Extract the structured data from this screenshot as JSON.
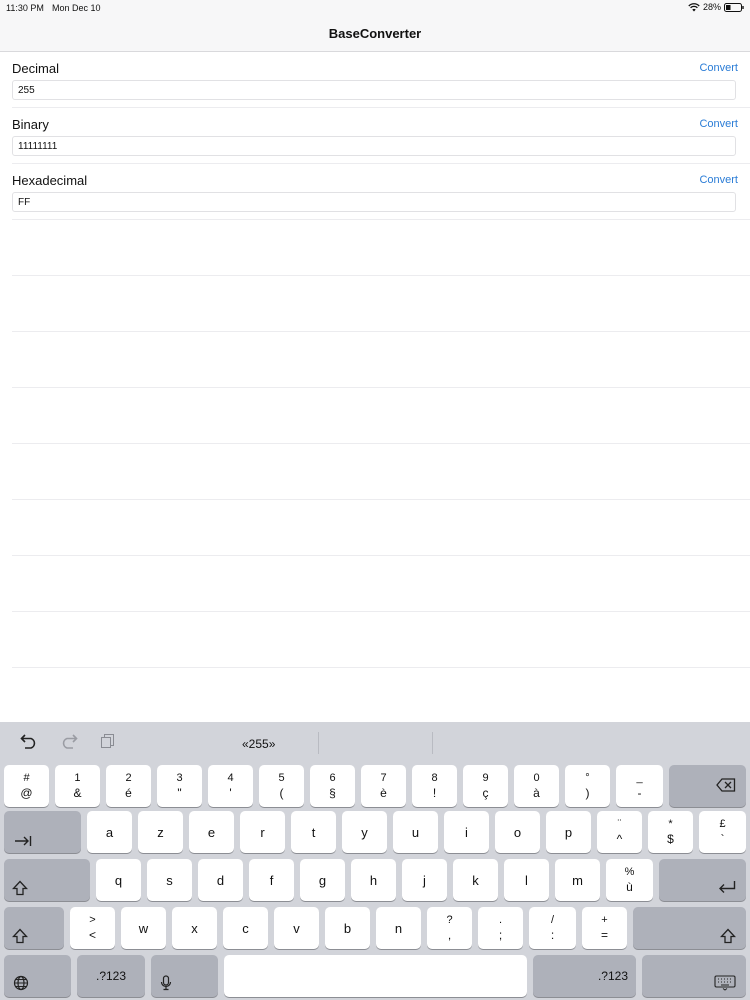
{
  "status_bar": {
    "time": "11:30 PM",
    "date": "Mon Dec 10",
    "battery": "28%"
  },
  "nav": {
    "title": "BaseConverter"
  },
  "rows": [
    {
      "label": "Decimal",
      "value": "255",
      "action": "Convert"
    },
    {
      "label": "Binary",
      "value": "11111111",
      "action": "Convert"
    },
    {
      "label": "Hexadecimal",
      "value": "FF",
      "action": "Convert"
    }
  ],
  "keyboard": {
    "suggestion": "«255»",
    "row1": [
      {
        "top": "#",
        "bottom": "@"
      },
      {
        "top": "1",
        "bottom": "&"
      },
      {
        "top": "2",
        "bottom": "é"
      },
      {
        "top": "3",
        "bottom": "\""
      },
      {
        "top": "4",
        "bottom": "'"
      },
      {
        "top": "5",
        "bottom": "("
      },
      {
        "top": "6",
        "bottom": "§"
      },
      {
        "top": "7",
        "bottom": "è"
      },
      {
        "top": "8",
        "bottom": "!"
      },
      {
        "top": "9",
        "bottom": "ç"
      },
      {
        "top": "0",
        "bottom": "à"
      },
      {
        "top": "°",
        "bottom": ")"
      },
      {
        "top": "_",
        "bottom": "-"
      }
    ],
    "row2": [
      "a",
      "z",
      "e",
      "r",
      "t",
      "y",
      "u",
      "i",
      "o",
      "p"
    ],
    "row2_extra": [
      {
        "top": "¨",
        "bottom": "^"
      },
      {
        "top": "*",
        "bottom": "$"
      },
      {
        "top": "£",
        "bottom": "`"
      }
    ],
    "row3": [
      "q",
      "s",
      "d",
      "f",
      "g",
      "h",
      "j",
      "k",
      "l",
      "m"
    ],
    "row3_extra": {
      "top": "%",
      "bottom": "ù"
    },
    "row4_first": {
      "top": ">",
      "bottom": "<"
    },
    "row4": [
      "w",
      "x",
      "c",
      "v",
      "b",
      "n"
    ],
    "row4_extra": [
      {
        "top": "?",
        "bottom": ","
      },
      {
        "top": ".",
        "bottom": ";"
      },
      {
        "top": "/",
        "bottom": ":"
      },
      {
        "top": "+",
        "bottom": "="
      }
    ],
    "numbers_label": ".?123"
  },
  "icons": {
    "undo": "undo-icon",
    "redo": "redo-icon",
    "paste": "paste-icon",
    "backspace": "backspace-icon",
    "tab": "tab-icon",
    "shift": "shift-icon",
    "return": "return-icon",
    "globe": "globe-icon",
    "mic": "microphone-icon",
    "hide_keyboard": "hide-keyboard-icon"
  },
  "colors": {
    "accent": "#2a7cd6",
    "keyboard_bg": "#d2d4da",
    "dark_key": "#aeb1ba"
  }
}
